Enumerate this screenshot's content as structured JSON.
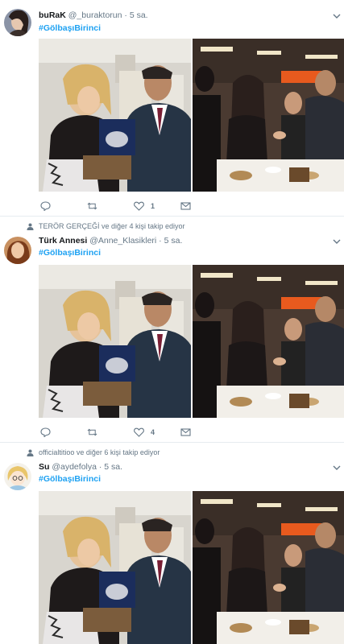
{
  "tweets": [
    {
      "context": "",
      "name": "buRaK",
      "handle": "@_buraktorun",
      "separator": "·",
      "time": "5 sa.",
      "hashtag": "#GölbaşıBirinci",
      "reply_count": "",
      "retweet_count": "",
      "like_count": "1"
    },
    {
      "context": "TERÖR GERÇEĞİ ve diğer 4 kişi takip ediyor",
      "name": "Türk Annesi",
      "handle": "@Anne_Klasikleri",
      "separator": "·",
      "time": "5 sa.",
      "hashtag": "#GölbaşıBirinci",
      "reply_count": "",
      "retweet_count": "",
      "like_count": "4"
    },
    {
      "context": "officialtitioo ve diğer 6 kişi takip ediyor",
      "name": "Su",
      "handle": "@aydefolya",
      "separator": "·",
      "time": "5 sa.",
      "hashtag": "#GölbaşıBirinci"
    }
  ],
  "icons": {
    "reply": "reply-icon",
    "retweet": "retweet-icon",
    "like": "heart-icon",
    "dm": "envelope-icon",
    "caret": "chevron-down-icon",
    "follow_context": "person-icon"
  },
  "colors": {
    "link": "#1da1f2",
    "muted": "#657786",
    "divider": "#e6ecf0"
  }
}
